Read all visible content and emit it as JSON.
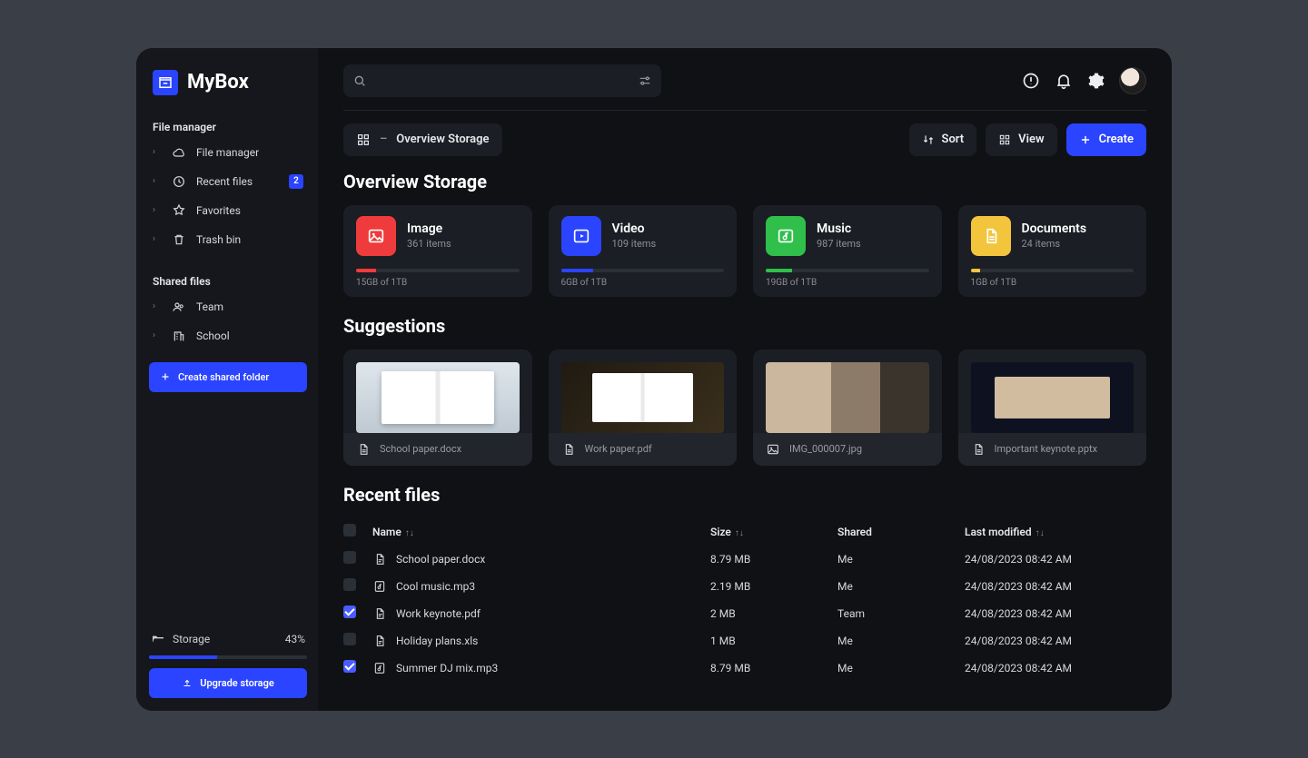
{
  "brand": {
    "title": "MyBox"
  },
  "sidebar": {
    "file_manager_title": "File manager",
    "file_manager_items": [
      {
        "label": "File manager"
      },
      {
        "label": "Recent files",
        "badge": "2"
      },
      {
        "label": "Favorites"
      },
      {
        "label": "Trash bin"
      }
    ],
    "shared_title": "Shared files",
    "shared_items": [
      {
        "label": "Team"
      },
      {
        "label": "School"
      }
    ],
    "create_shared_label": "Create shared folder",
    "storage_label": "Storage",
    "storage_percent": "43%",
    "storage_fill_pct": 43,
    "upgrade_label": "Upgrade storage"
  },
  "toolbar": {
    "breadcrumb": "Overview Storage",
    "breadcrumb_sep": "–",
    "sort_label": "Sort",
    "view_label": "View",
    "create_label": "Create"
  },
  "overview": {
    "heading": "Overview Storage",
    "cards": [
      {
        "title": "Image",
        "items": "361 items",
        "usage": "15GB of 1TB",
        "color": "#ef3b3b",
        "fill_pct": 12
      },
      {
        "title": "Video",
        "items": "109 items",
        "usage": "6GB of 1TB",
        "color": "#2a44ff",
        "fill_pct": 20
      },
      {
        "title": "Music",
        "items": "987 items",
        "usage": "19GB of 1TB",
        "color": "#2fbf4a",
        "fill_pct": 16
      },
      {
        "title": "Documents",
        "items": "24 items",
        "usage": "1GB of 1TB",
        "color": "#f2c53d",
        "fill_pct": 6
      }
    ]
  },
  "suggestions": {
    "heading": "Suggestions",
    "items": [
      {
        "name": "School paper.docx"
      },
      {
        "name": "Work paper.pdf"
      },
      {
        "name": "IMG_000007.jpg"
      },
      {
        "name": "Important keynote.pptx"
      }
    ]
  },
  "recent": {
    "heading": "Recent files",
    "columns": {
      "name": "Name",
      "size": "Size",
      "shared": "Shared",
      "modified": "Last modified"
    },
    "rows": [
      {
        "checked": false,
        "name": "School paper.docx",
        "size": "8.79 MB",
        "shared": "Me",
        "modified": "24/08/2023 08:42 AM"
      },
      {
        "checked": false,
        "name": "Cool music.mp3",
        "size": "2.19 MB",
        "shared": "Me",
        "modified": "24/08/2023 08:42 AM"
      },
      {
        "checked": true,
        "name": "Work keynote.pdf",
        "size": "2 MB",
        "shared": "Team",
        "modified": "24/08/2023 08:42 AM"
      },
      {
        "checked": false,
        "name": "Holiday plans.xls",
        "size": "1 MB",
        "shared": "Me",
        "modified": "24/08/2023 08:42 AM"
      },
      {
        "checked": true,
        "name": "Summer DJ mix.mp3",
        "size": "8.79 MB",
        "shared": "Me",
        "modified": "24/08/2023 08:42 AM"
      }
    ]
  }
}
